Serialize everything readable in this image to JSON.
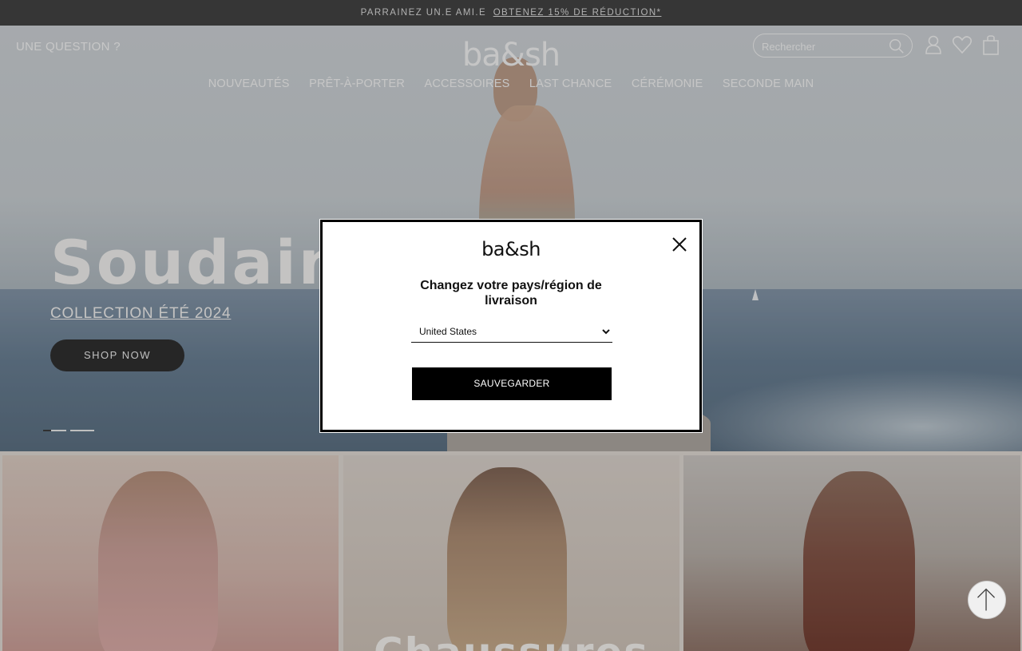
{
  "promo": {
    "text": "PARRAINEZ UN.E AMI.E",
    "link": "OBTENEZ 15% DE RÉDUCTION*"
  },
  "header": {
    "question": "UNE QUESTION ?",
    "logo": "ba&sh",
    "search_placeholder": "Rechercher",
    "icons": [
      "search-icon",
      "account-icon",
      "wishlist-heart-icon",
      "shopping-bag-icon"
    ]
  },
  "nav": {
    "items": [
      "NOUVEAUTÉS",
      "PRÊT-À-PORTER",
      "ACCESSOIRES",
      "LAST CHANCE",
      "CÉRÉMONIE",
      "SECONDE MAIN"
    ]
  },
  "hero": {
    "title": "Soudain, l",
    "subtitle": "COLLECTION ÉTÉ 2024",
    "cta": "SHOP NOW"
  },
  "tiles": {
    "middle_title": "Chaussures"
  },
  "modal": {
    "logo": "ba&sh",
    "title": "Changez votre pays/région de livraison",
    "selected_country": "United States",
    "save_label": "SAUVEGARDER"
  },
  "colors": {
    "promo_bar": "#3a3a3a",
    "button_dark": "#000000",
    "modal_bg": "#ffffff"
  }
}
